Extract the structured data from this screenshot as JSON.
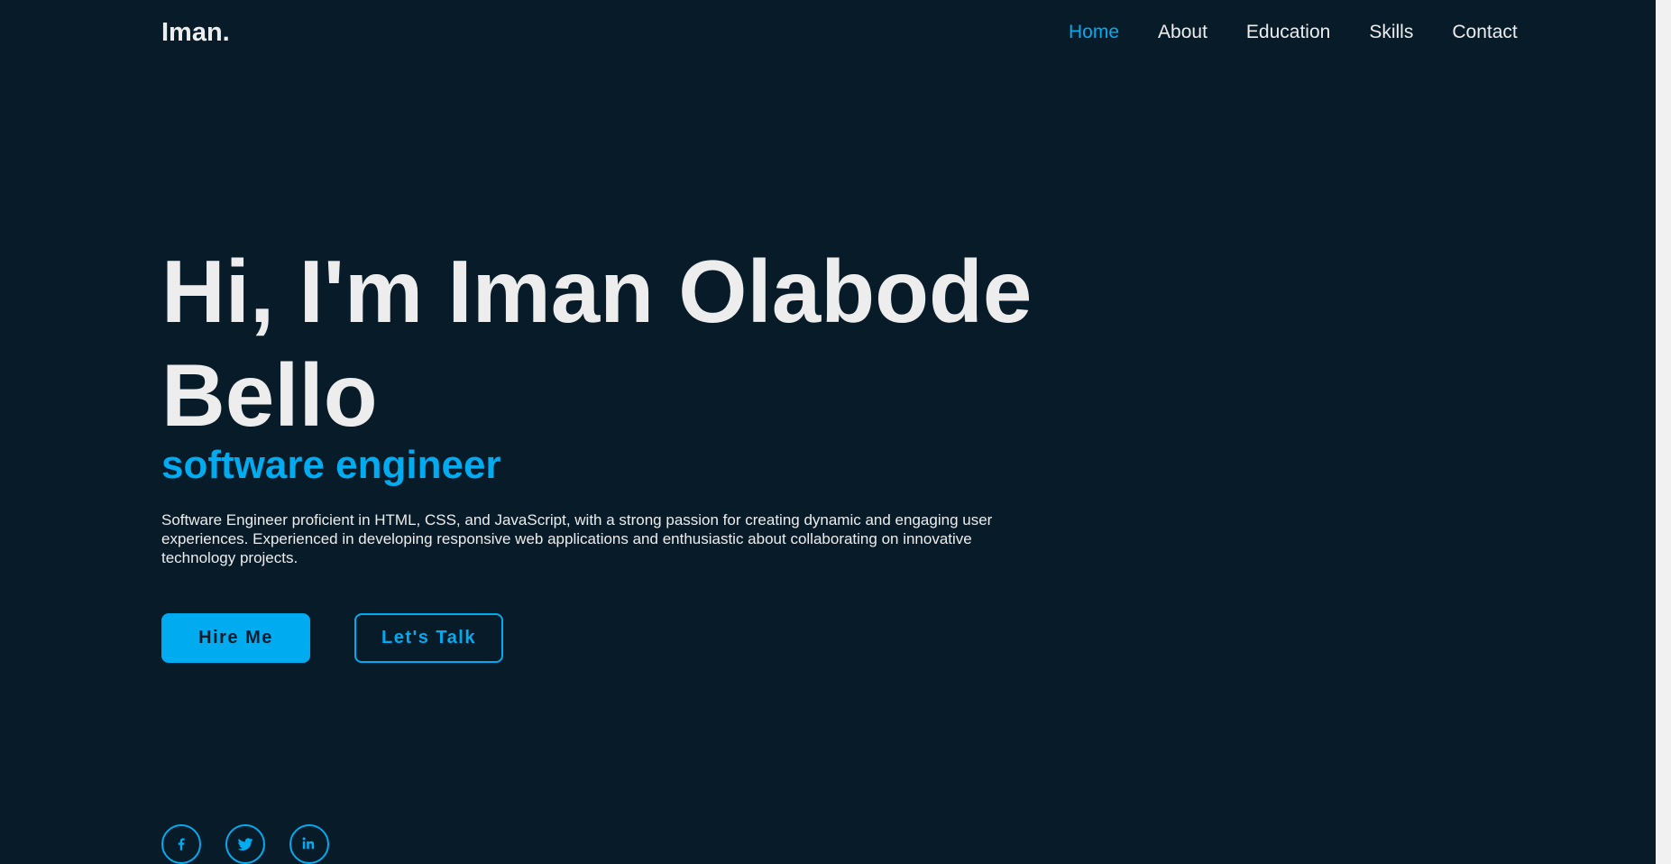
{
  "header": {
    "logo": "Iman.",
    "nav": [
      {
        "label": "Home",
        "active": true
      },
      {
        "label": "About",
        "active": false
      },
      {
        "label": "Education",
        "active": false
      },
      {
        "label": "Skills",
        "active": false
      },
      {
        "label": "Contact",
        "active": false
      }
    ]
  },
  "hero": {
    "title": "Hi, I'm Iman Olabode Bello",
    "subtitle": "software engineer",
    "description": "Software Engineer proficient in HTML, CSS, and JavaScript, with a strong passion for creating dynamic and engaging user experiences. Experienced in developing responsive web applications and enthusiastic about collaborating on innovative technology projects.",
    "buttons": {
      "primary": "Hire Me",
      "secondary": "Let's Talk"
    }
  },
  "social": [
    {
      "icon": "facebook-icon"
    },
    {
      "icon": "twitter-icon"
    },
    {
      "icon": "linkedin-icon"
    }
  ],
  "colors": {
    "background": "#081b29",
    "accent": "#00abf0",
    "text": "#ededed"
  }
}
